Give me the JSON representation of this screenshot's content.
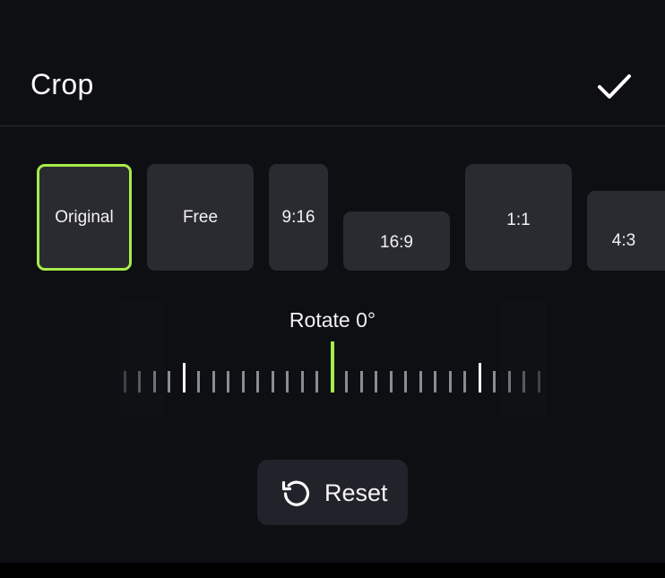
{
  "header": {
    "title": "Crop",
    "confirm_icon": "checkmark-icon"
  },
  "aspect_ratios": [
    {
      "label": "Original",
      "selected": true
    },
    {
      "label": "Free",
      "selected": false
    },
    {
      "label": "9:16",
      "selected": false
    },
    {
      "label": "16:9",
      "selected": false
    },
    {
      "label": "1:1",
      "selected": false
    },
    {
      "label": "4:3",
      "selected": false
    }
  ],
  "rotate": {
    "label": "Rotate 0°",
    "value_degrees": 0
  },
  "reset": {
    "label": "Reset",
    "icon": "reset-rotate-icon"
  },
  "colors": {
    "accent": "#a6ec4a",
    "background": "#0e0f13",
    "tile": "#2a2b31"
  }
}
